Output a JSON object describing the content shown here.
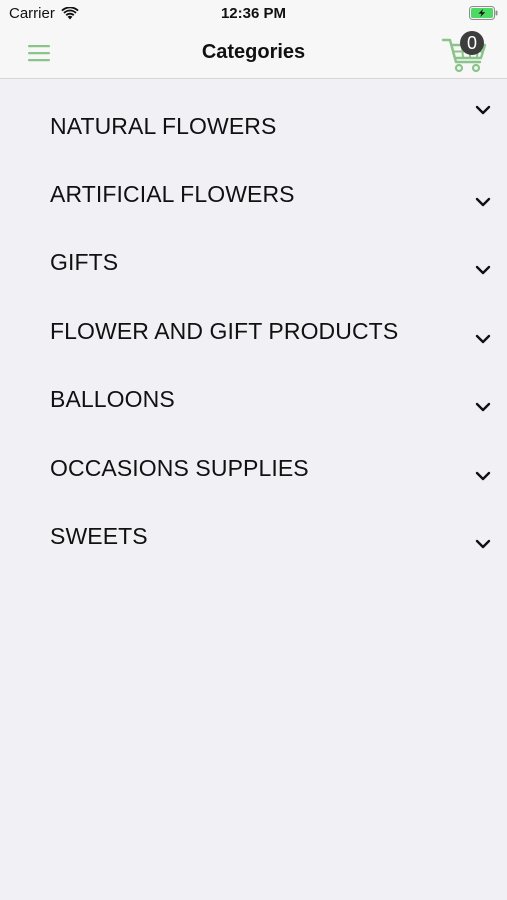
{
  "status_bar": {
    "carrier": "Carrier",
    "time": "12:36 PM",
    "wifi_icon": "wifi-icon",
    "battery_icon": "battery-charging-icon"
  },
  "nav": {
    "title": "Categories",
    "menu_icon": "hamburger-menu-icon",
    "cart_icon": "shopping-cart-icon",
    "cart_count": "0"
  },
  "categories": [
    {
      "label": "NATURAL FLOWERS"
    },
    {
      "label": "ARTIFICIAL FLOWERS"
    },
    {
      "label": "GIFTS"
    },
    {
      "label": "FLOWER AND GIFT PRODUCTS"
    },
    {
      "label": "BALLOONS"
    },
    {
      "label": "OCCASIONS SUPPLIES"
    },
    {
      "label": "SWEETS"
    }
  ],
  "colors": {
    "accent": "#8bc48a",
    "background": "#f1f0f5",
    "nav_background": "#f7f7f7",
    "badge": "#3d3d3d",
    "battery_fill": "#4cd964"
  }
}
